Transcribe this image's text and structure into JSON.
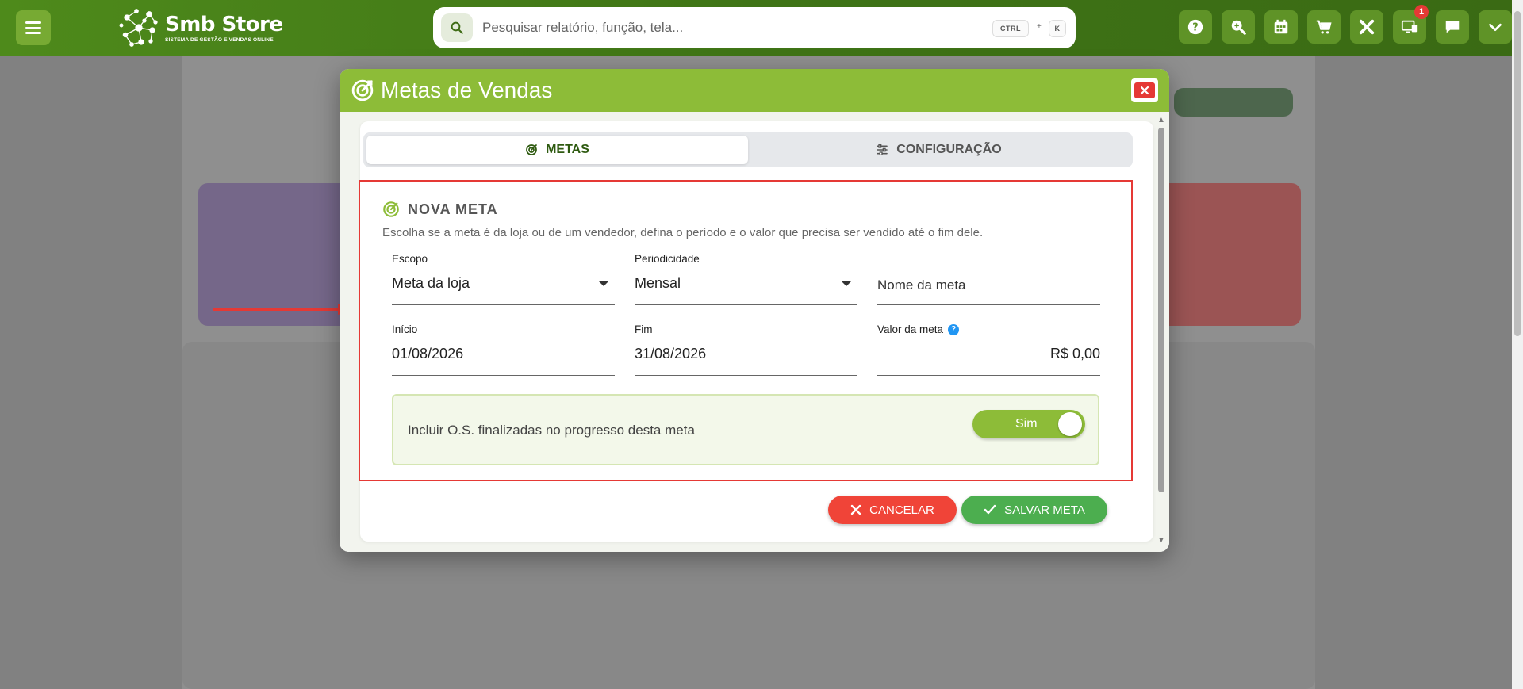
{
  "app": {
    "logo_title": "Smb Store",
    "logo_subtitle": "SISTEMA DE GESTÃO E VENDAS ONLINE",
    "search_placeholder": "Pesquisar relatório, função, tela...",
    "shortcut_ctrl": "CTRL",
    "shortcut_plus": "+",
    "shortcut_key": "K",
    "notification_count": "1",
    "toolbar_icons": [
      "help-icon",
      "zoom-icon",
      "calendar-icon",
      "cart-icon",
      "tools-icon",
      "monitor-icon",
      "chat-icon",
      "chevron-down-icon"
    ]
  },
  "modal": {
    "title": "Metas de Vendas",
    "tabs": [
      {
        "label": "METAS",
        "active": true
      },
      {
        "label": "CONFIGURAÇÃO",
        "active": false
      }
    ],
    "section": {
      "title": "NOVA META",
      "description": "Escolha se a meta é da loja ou de um vendedor, defina o período e o valor que precisa ser vendido até o fim dele."
    },
    "fields": {
      "escopo": {
        "label": "Escopo",
        "value": "Meta da loja"
      },
      "periodicidade": {
        "label": "Periodicidade",
        "value": "Mensal"
      },
      "nome": {
        "placeholder": "Nome da meta"
      },
      "inicio": {
        "label": "Início",
        "value": "01/08/2026"
      },
      "fim": {
        "label": "Fim",
        "value": "31/08/2026"
      },
      "valor": {
        "label": "Valor da meta",
        "value": "R$ 0,00",
        "help": "?"
      }
    },
    "toggle": {
      "label": "Incluir O.S. finalizadas no progresso desta meta",
      "value": "Sim"
    },
    "buttons": {
      "cancel": "CANCELAR",
      "save": "SALVAR META"
    }
  },
  "colors": {
    "primary_green": "#8dbc38",
    "topbar_green": "#3f7416",
    "cancel_red": "#f04438",
    "save_green": "#4cae4f",
    "highlight_red": "#e53935"
  }
}
